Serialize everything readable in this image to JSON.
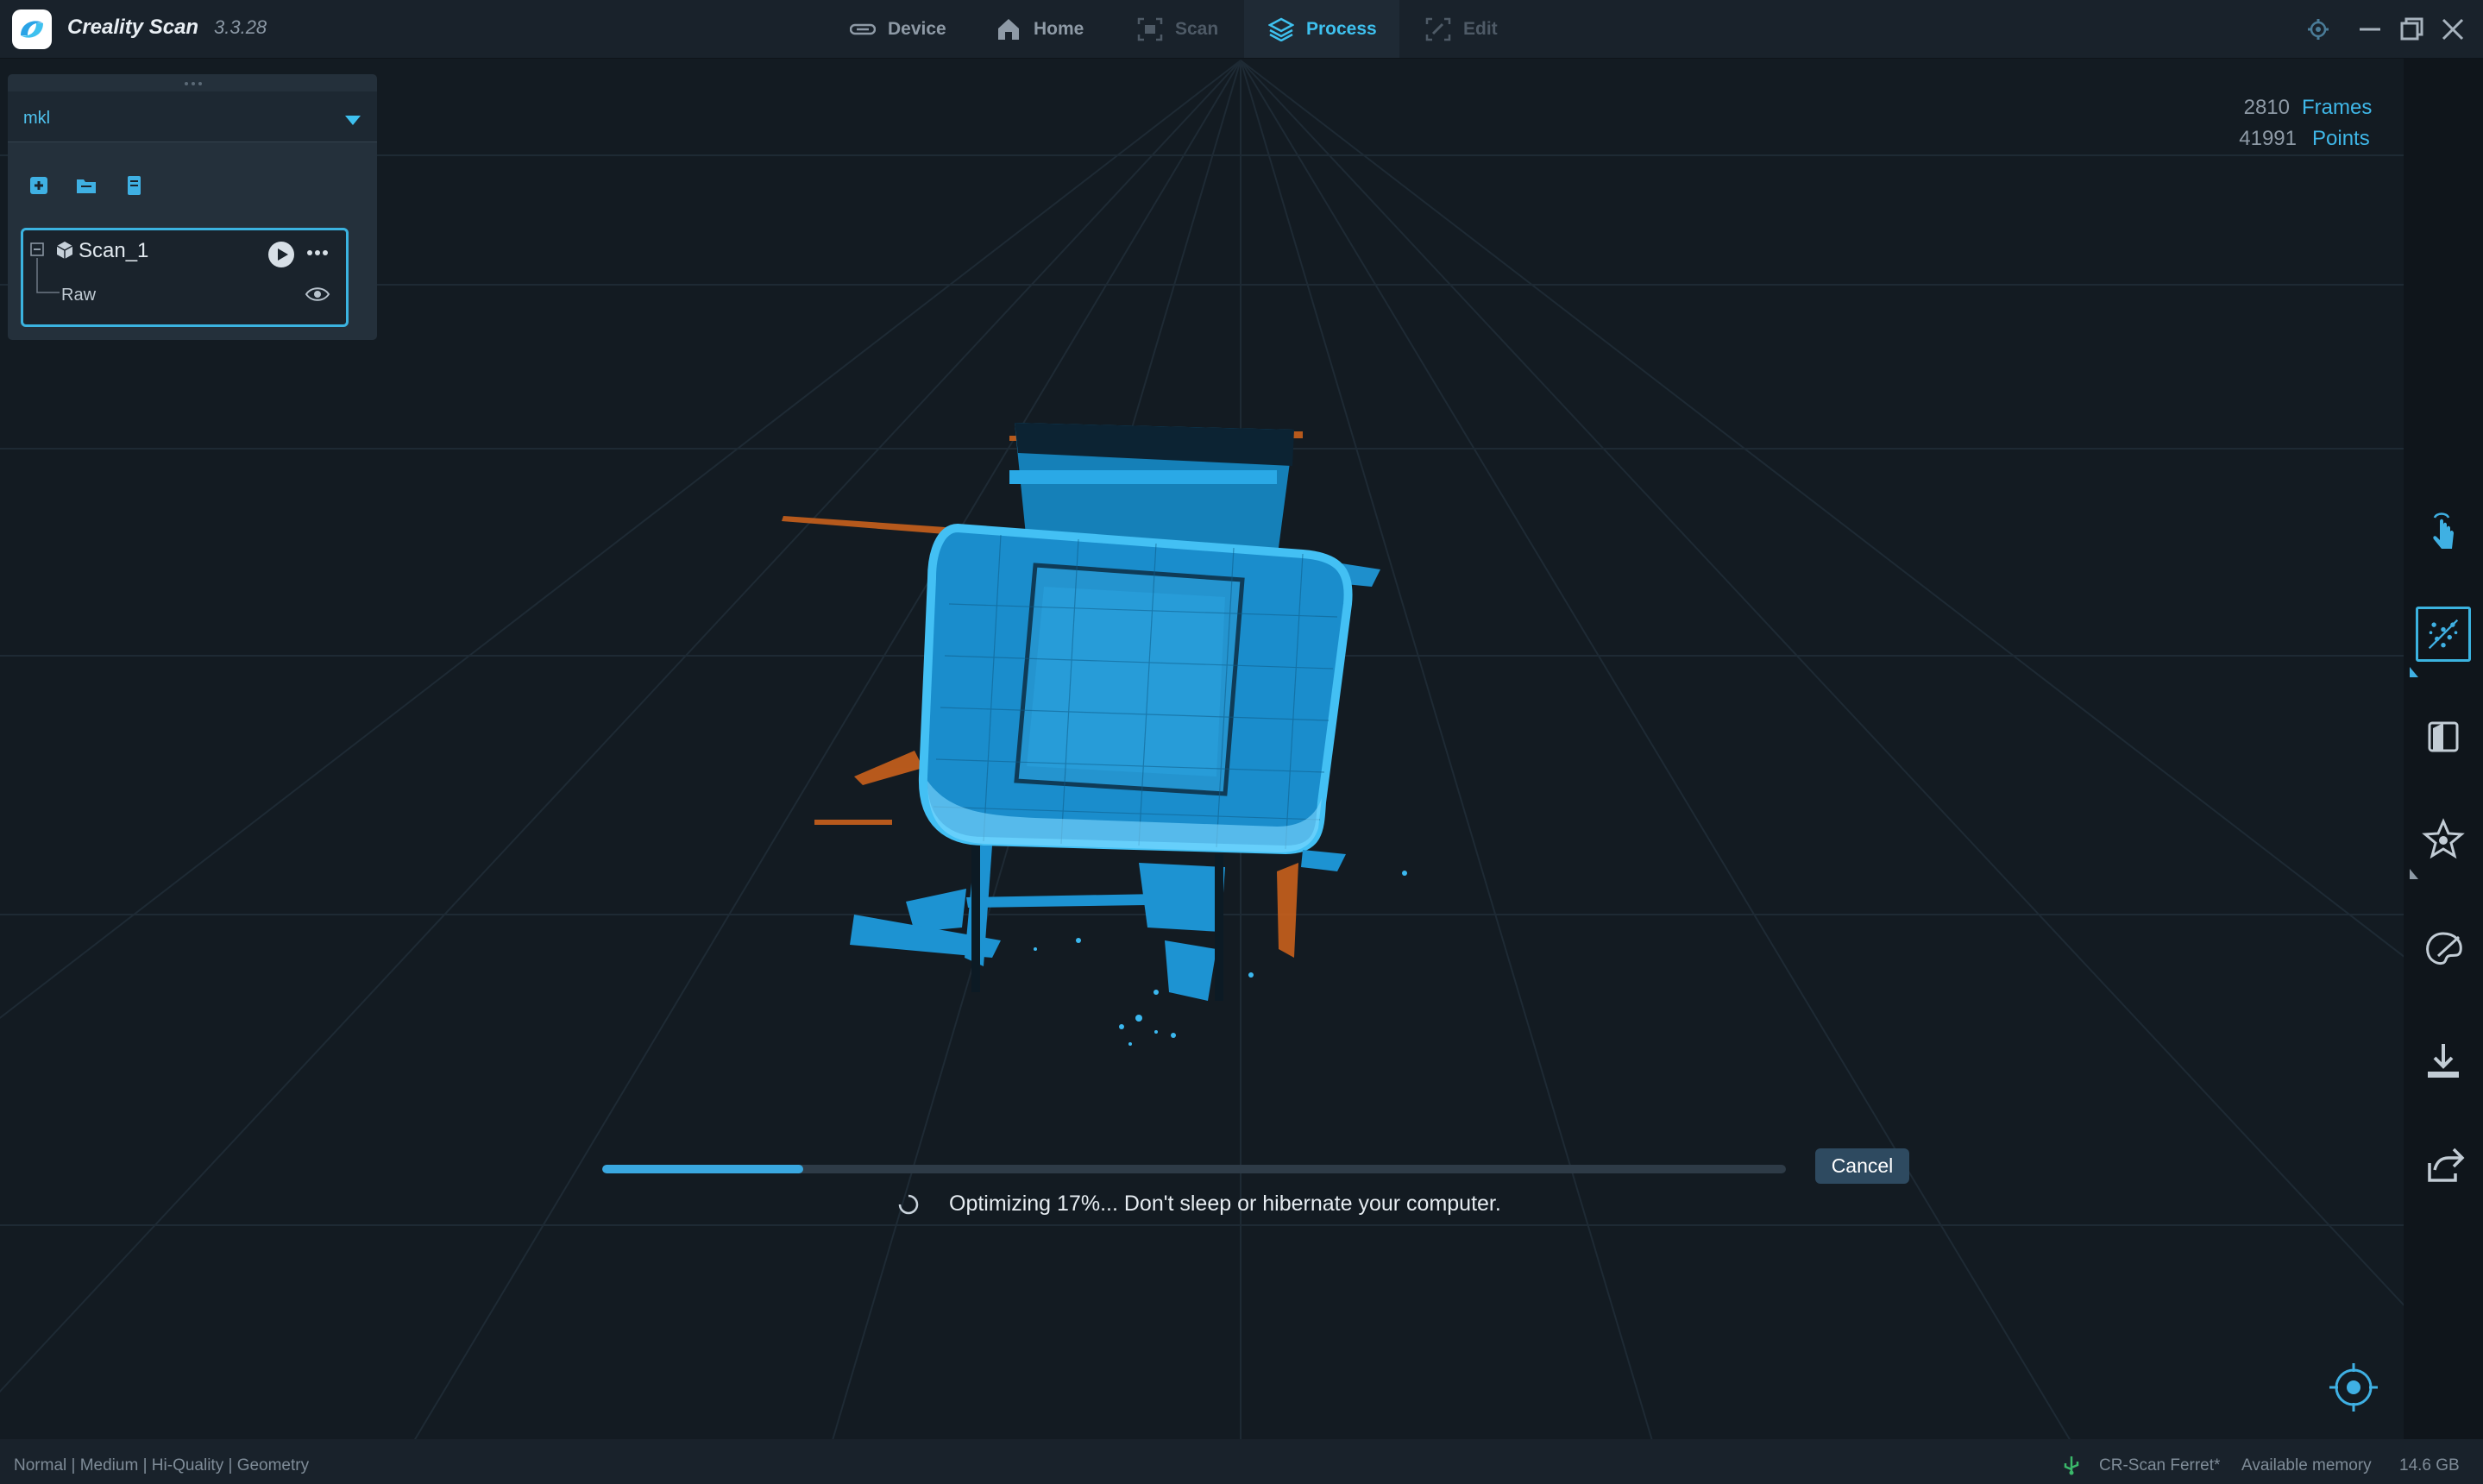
{
  "app": {
    "name": "Creality Scan",
    "version": "3.3.28"
  },
  "nav": {
    "tabs": [
      {
        "label": "Device",
        "state": "normal"
      },
      {
        "label": "Home",
        "state": "normal"
      },
      {
        "label": "Scan",
        "state": "disabled"
      },
      {
        "label": "Process",
        "state": "active"
      },
      {
        "label": "Edit",
        "state": "disabled"
      }
    ]
  },
  "window_controls": [
    "settings-icon",
    "minimize-icon",
    "restore-icon",
    "close-icon"
  ],
  "left_panel": {
    "project": "mkl",
    "tools": [
      "add-icon",
      "open-folder-icon",
      "document-icon"
    ],
    "scan": {
      "name": "Scan_1",
      "child": "Raw"
    }
  },
  "stats": {
    "frames_value": "2810",
    "frames_label": "Frames",
    "points_value": "41991",
    "points_label": "Points"
  },
  "right_toolbar": [
    "hand-pointer-icon",
    "point-cloud-icon",
    "split-icon",
    "star-icon",
    "palette-icon",
    "download-icon",
    "share-icon"
  ],
  "progress": {
    "percent": 17,
    "message": "Optimizing 17%... Don't sleep or hibernate your computer.",
    "cancel_label": "Cancel"
  },
  "status_bar": {
    "mode": "Normal | Medium | Hi-Quality | Geometry",
    "device": "CR-Scan Ferret*",
    "memory_label": "Available memory",
    "memory_value": "14.6 GB"
  },
  "colors": {
    "accent": "#3ec1ef",
    "background": "#131b22",
    "pointcloud_primary": "#1e9fd9",
    "pointcloud_secondary": "#d4681e"
  }
}
